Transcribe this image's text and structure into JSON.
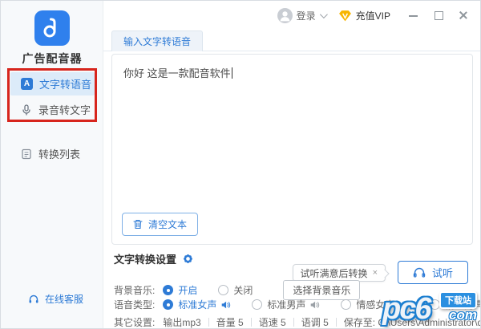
{
  "colors": {
    "accent": "#2e7bd6",
    "annotation": "#d7251d",
    "vip_gold": "#f7b500"
  },
  "sidebar": {
    "app_title": "广告配音器",
    "nav_icon_letter": "A",
    "nav": [
      {
        "label": "文字转语音"
      },
      {
        "label": "录音转文字"
      },
      {
        "label": "转换列表"
      }
    ],
    "customer_service": "在线客服"
  },
  "titlebar": {
    "login_label": "登录",
    "vip_label": "充值VIP"
  },
  "tabs": {
    "active": "输入文字转语音"
  },
  "editor": {
    "text": "你好 这是一款配音软件",
    "clear_button": "清空文本"
  },
  "settings": {
    "title": "文字转换设置",
    "tooltip": "试听满意后转换",
    "tooltip_close": "×",
    "listen_button": "试听",
    "bgm": {
      "label": "背景音乐:",
      "on": "开启",
      "off": "关闭",
      "choose_button": "选择背景音乐"
    },
    "voice": {
      "label": "语音类型:",
      "options": [
        "标准女声",
        "标准男声",
        "情感女声",
        "情感男声"
      ]
    },
    "other": {
      "label": "其它设置:",
      "items": [
        "输出mp3",
        "音量 5",
        "语速 5",
        "语调 5",
        "保存至: C:\\Users\\Administrator\\deskto"
      ]
    }
  },
  "watermark": {
    "main": "pc6",
    "badge": "下载站",
    "suffix": "com"
  }
}
